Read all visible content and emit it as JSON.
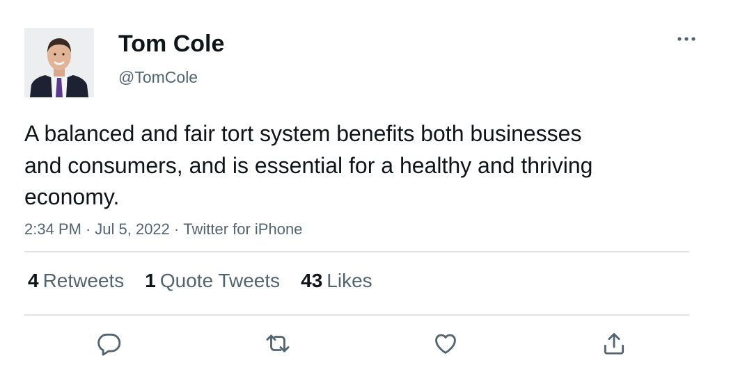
{
  "author": {
    "name": "Tom Cole",
    "handle": "@TomCole",
    "avatar_icon": "profile-photo"
  },
  "tweet": {
    "text": "A balanced and fair tort system benefits both businesses and consumers, and is essential for a healthy and thriving economy.",
    "time": "2:34 PM",
    "date": "Jul 5, 2022",
    "source": "Twitter for iPhone",
    "separator": "·"
  },
  "stats": {
    "retweets": {
      "count": "4",
      "label": "Retweets"
    },
    "quotes": {
      "count": "1",
      "label": "Quote Tweets"
    },
    "likes": {
      "count": "43",
      "label": "Likes"
    }
  },
  "actions": {
    "reply_icon": "reply-icon",
    "retweet_icon": "retweet-icon",
    "like_icon": "heart-icon",
    "share_icon": "share-icon"
  },
  "colors": {
    "text_primary": "#0f1419",
    "text_secondary": "#536471",
    "divider": "#dfe3e6"
  }
}
